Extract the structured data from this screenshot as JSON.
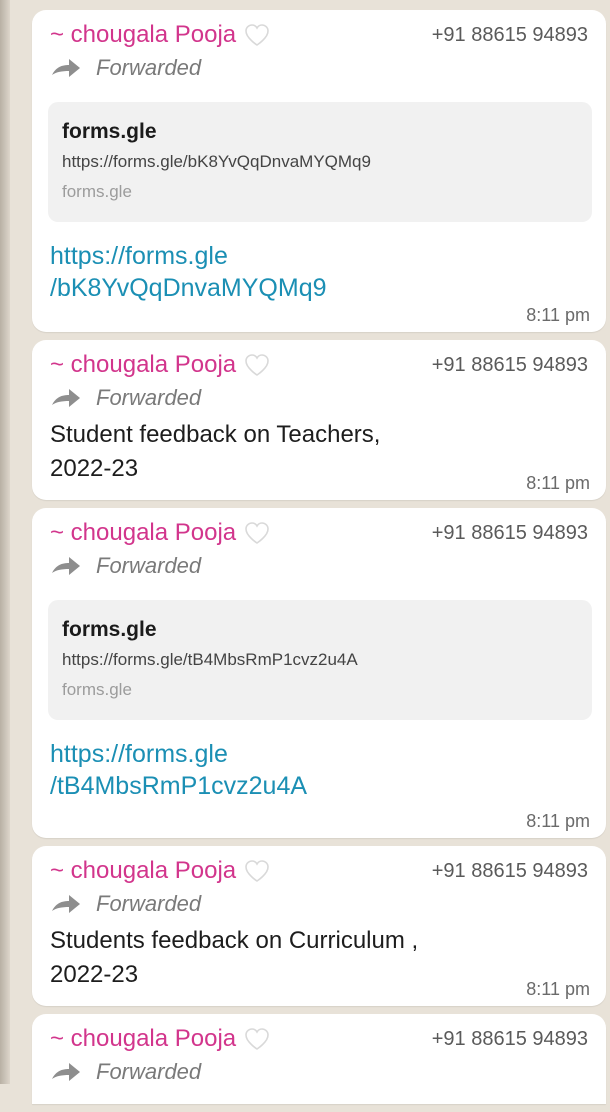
{
  "colors": {
    "background": "#e8e2d8",
    "bubble": "#ffffff",
    "sender": "#d2358c",
    "link": "#1b8fb4"
  },
  "messages": [
    {
      "sender": "~ chougala Pooja",
      "phone": "+91 88615 94893",
      "forwarded": "Forwarded",
      "preview": {
        "title": "forms.gle",
        "url": "https://forms.gle/bK8YvQqDnvaMYQMq9",
        "domain": "forms.gle"
      },
      "link_line1": "https://forms.gle",
      "link_line2": "/bK8YvQqDnvaMYQMq9",
      "time": "8:11 pm"
    },
    {
      "sender": "~ chougala Pooja",
      "phone": "+91 88615 94893",
      "forwarded": "Forwarded",
      "text_line1": "Student feedback on Teachers,",
      "text_line2": "2022-23",
      "time": "8:11 pm"
    },
    {
      "sender": "~ chougala Pooja",
      "phone": "+91 88615 94893",
      "forwarded": "Forwarded",
      "preview": {
        "title": "forms.gle",
        "url": "https://forms.gle/tB4MbsRmP1cvz2u4A",
        "domain": "forms.gle"
      },
      "link_line1": "https://forms.gle",
      "link_line2": "/tB4MbsRmP1cvz2u4A",
      "time": "8:11 pm"
    },
    {
      "sender": "~ chougala Pooja",
      "phone": "+91 88615 94893",
      "forwarded": "Forwarded",
      "text_line1": "Students feedback on Curriculum ,",
      "text_line2": "2022-23",
      "time": "8:11 pm"
    },
    {
      "sender": "~ chougala Pooja",
      "phone": "+91 88615 94893",
      "forwarded": "Forwarded"
    }
  ]
}
